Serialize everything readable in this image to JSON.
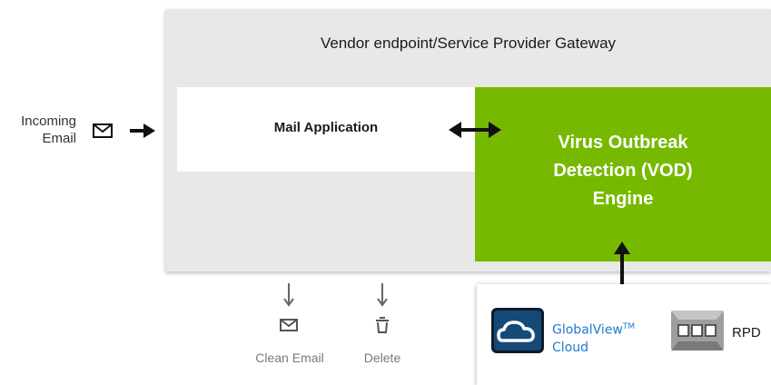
{
  "diagram": {
    "gateway_title": "Vendor endpoint/Service Provider Gateway",
    "mail_app_label": "Mail Application",
    "vod_label_lines": [
      "Virus Outbreak",
      "Detection (VOD)",
      "Engine"
    ],
    "incoming_lines": [
      "Incoming",
      "Email"
    ],
    "actions": {
      "clean_email": "Clean Email",
      "delete": "Delete"
    },
    "cloud_panel": {
      "globalview_line1": "GlobalView",
      "globalview_tm": "TM",
      "globalview_line2": "Cloud",
      "rpd": "RPD"
    }
  },
  "colors": {
    "gateway_bg": "#e8e8e8",
    "vod_green": "#76b900",
    "globalview_blue": "#1f79d1",
    "action_gray": "#7a7a7a"
  },
  "icons": [
    "envelope-icon",
    "arrow-right-icon",
    "bidirectional-arrow-icon",
    "arrow-down-icon",
    "trash-icon",
    "cloud-icon",
    "rpd-icon"
  ]
}
